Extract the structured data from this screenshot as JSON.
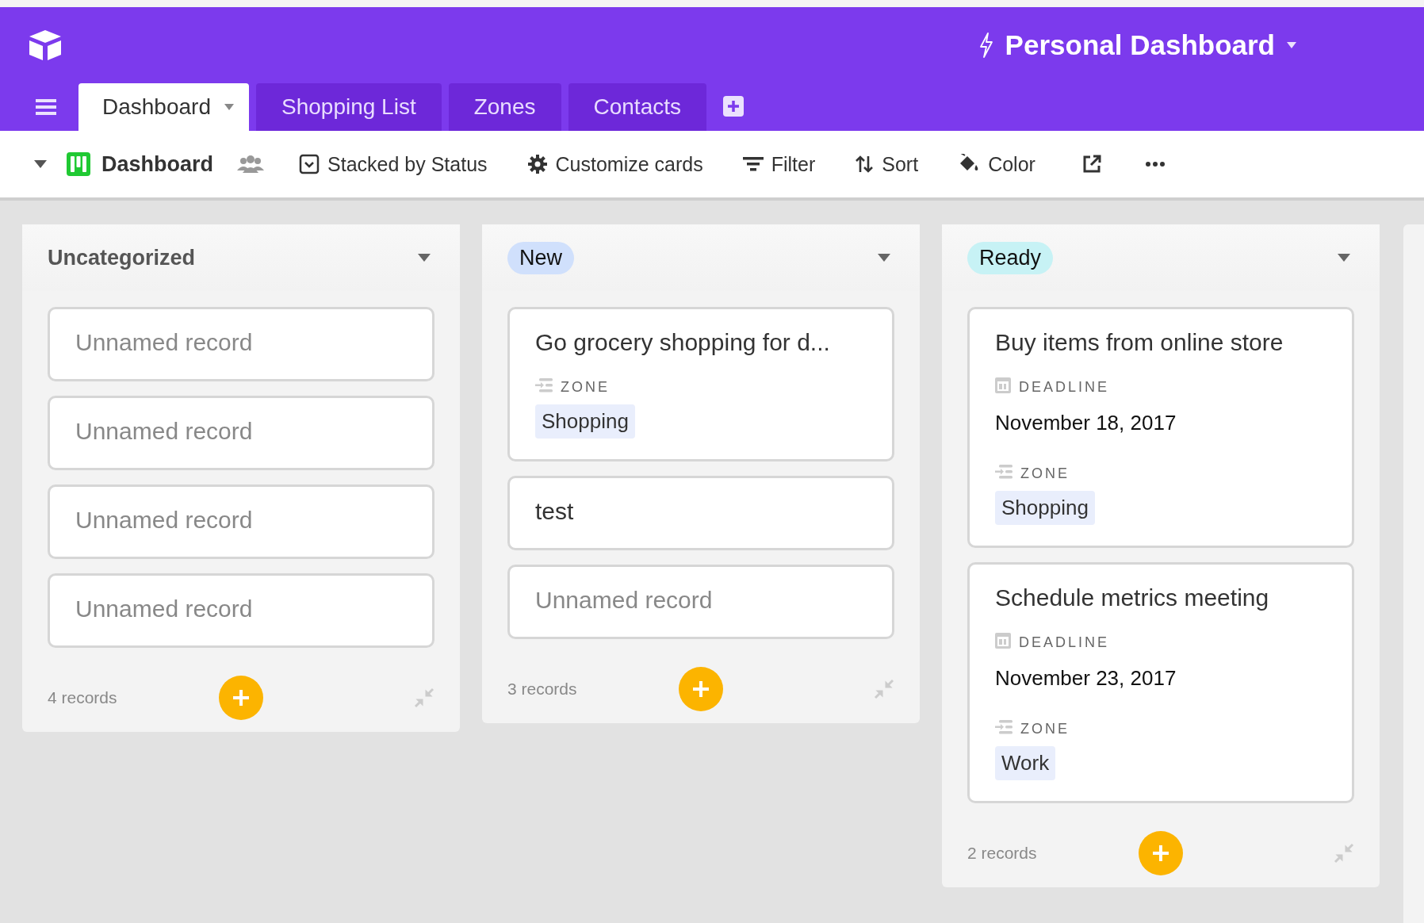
{
  "header": {
    "title": "Personal Dashboard"
  },
  "tabs": [
    {
      "label": "Dashboard",
      "selected": true
    },
    {
      "label": "Shopping List",
      "selected": false
    },
    {
      "label": "Zones",
      "selected": false
    },
    {
      "label": "Contacts",
      "selected": false
    }
  ],
  "toolbar": {
    "view_name": "Dashboard",
    "items": [
      {
        "kind": "stack",
        "label": "Stacked by Status"
      },
      {
        "kind": "customize",
        "label": "Customize cards"
      },
      {
        "kind": "filter",
        "label": "Filter"
      },
      {
        "kind": "sort",
        "label": "Sort"
      },
      {
        "kind": "color",
        "label": "Color"
      },
      {
        "kind": "share"
      },
      {
        "kind": "more"
      }
    ]
  },
  "columns": [
    {
      "title": "Uncategorized",
      "kind": "plain",
      "count": "4 records",
      "cards": [
        {
          "title": "Unnamed record",
          "unnamed": true
        },
        {
          "title": "Unnamed record",
          "unnamed": true
        },
        {
          "title": "Unnamed record",
          "unnamed": true
        },
        {
          "title": "Unnamed record",
          "unnamed": true
        }
      ]
    },
    {
      "title": "New",
      "kind": "pill",
      "color": "#d0e0fc",
      "count": "3 records",
      "cards": [
        {
          "title": "Go grocery shopping for d...",
          "unnamed": false,
          "fields": [
            {
              "kind": "select",
              "label": "ZONE",
              "value": "Shopping"
            }
          ]
        },
        {
          "title": "test",
          "unnamed": false
        },
        {
          "title": "Unnamed record",
          "unnamed": true
        }
      ]
    },
    {
      "title": "Ready",
      "kind": "pill",
      "color": "#c7f2f5",
      "count": "2 records",
      "cards": [
        {
          "title": "Buy items from online store",
          "unnamed": false,
          "fields": [
            {
              "kind": "date",
              "label": "DEADLINE",
              "value": "November 18, 2017"
            },
            {
              "kind": "select",
              "label": "ZONE",
              "value": "Shopping"
            }
          ]
        },
        {
          "title": "Schedule metrics meeting",
          "unnamed": false,
          "fields": [
            {
              "kind": "date",
              "label": "DEADLINE",
              "value": "November 23, 2017"
            },
            {
              "kind": "select",
              "label": "ZONE",
              "value": "Work"
            }
          ]
        }
      ]
    }
  ]
}
